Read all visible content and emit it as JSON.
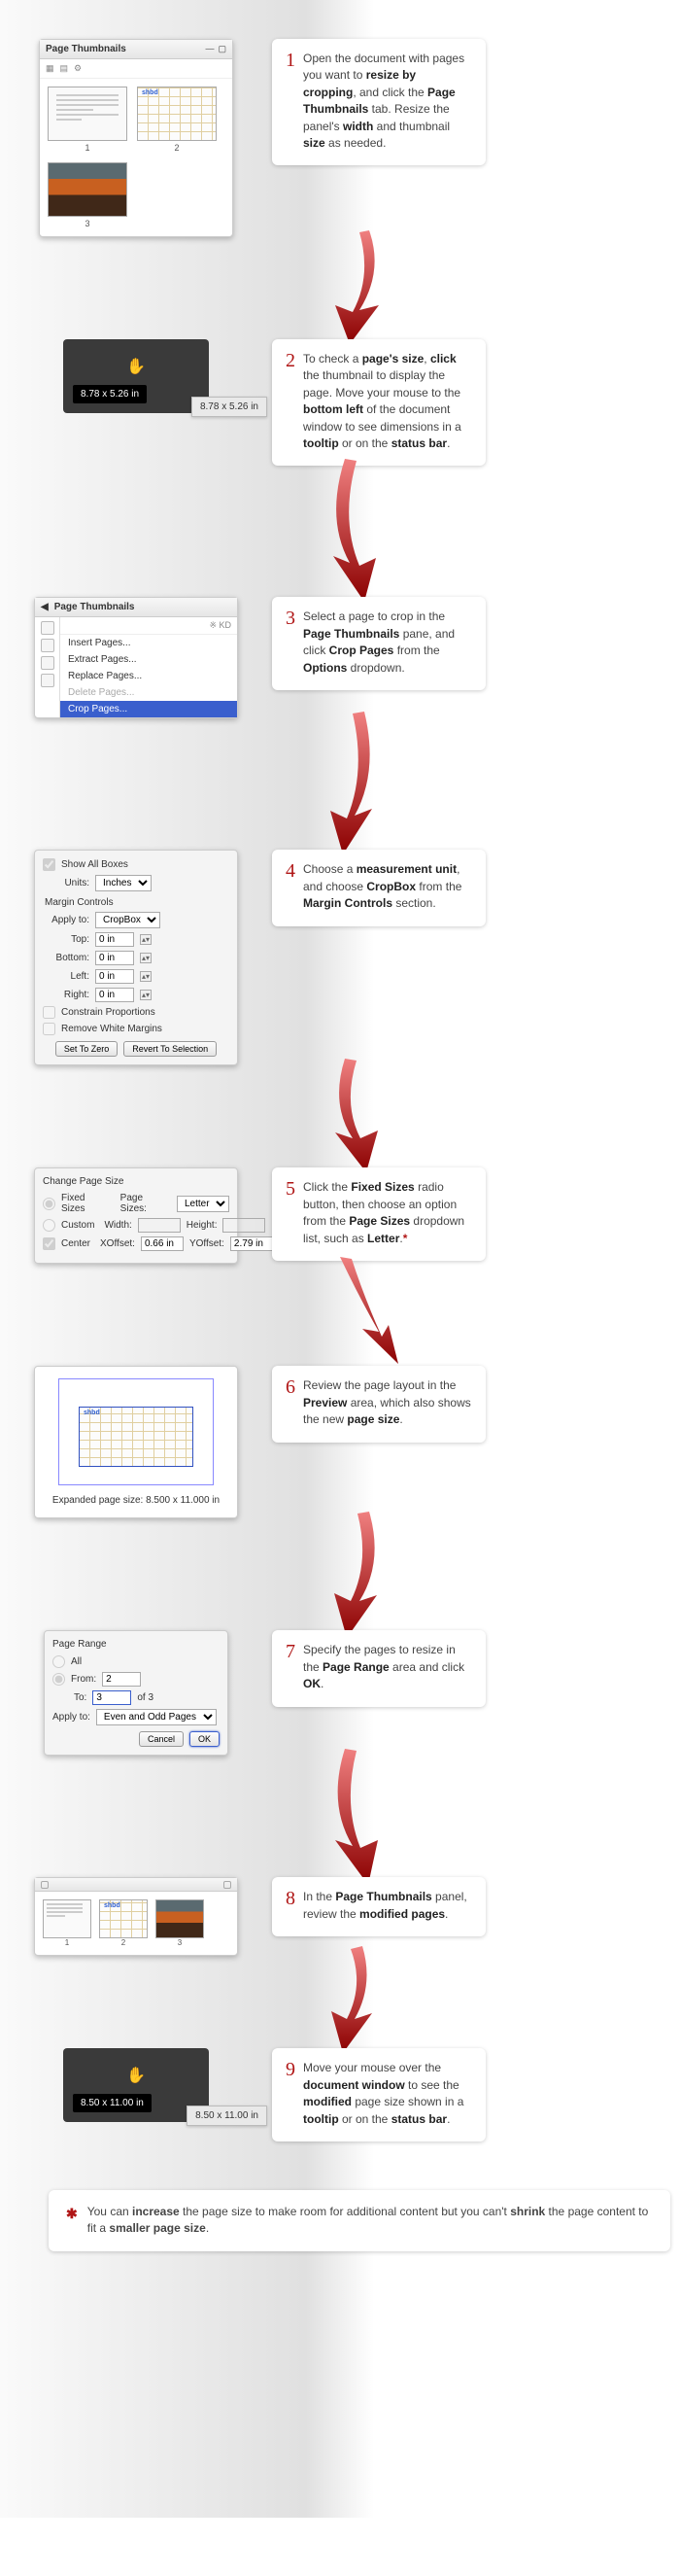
{
  "steps": {
    "1": {
      "part_a": "Open the document with pages you want to ",
      "b1": "resize by cropping",
      "mid1": ", and click the ",
      "b2": "Page Thumbnails",
      "mid2": " tab. Resize the panel's ",
      "b3": "width",
      "mid3": " and thumbnail ",
      "b4": "size",
      "end": " as needed."
    },
    "2": {
      "a": "To check a ",
      "b1": "page's size",
      "m1": ", ",
      "b2": "click",
      "m2": " the thumbnail to display the page. Move your mouse to the ",
      "b3": "bottom left",
      "m3": " of the document window to see dimensions in a ",
      "b4": "tooltip",
      "m4": " or on the ",
      "b5": "status bar",
      "end": "."
    },
    "3": {
      "a": "Select a page to crop in the ",
      "b1": "Page Thumbnails",
      "m1": " pane, and click ",
      "b2": "Crop Pages",
      "m2": " from the ",
      "b3": "Options",
      "end": " dropdown."
    },
    "4": {
      "a": "Choose a ",
      "b1": "measurement unit",
      "m1": ", and choose ",
      "b2": "CropBox",
      "m2": " from the ",
      "b3": "Margin Controls",
      "end": " section."
    },
    "5": {
      "a": "Click the ",
      "b1": "Fixed Sizes",
      "m1": " radio button, then choose an option from the ",
      "b2": "Page Sizes",
      "m2": " dropdown list, such as ",
      "b3": "Letter",
      "end": "."
    },
    "6": {
      "a": " Review the page layout in the ",
      "b1": "Preview",
      "m1": " area, which also shows the new ",
      "b2": "page size",
      "end": "."
    },
    "7": {
      "a": "Specify the pages to resize in the ",
      "b1": "Page Range",
      "m1": " area and click ",
      "b2": "OK",
      "end": "."
    },
    "8": {
      "a": "In the ",
      "b1": "Page Thumbnails",
      "m1": " panel, review the ",
      "b2": "modified pages",
      "end": "."
    },
    "9": {
      "a": "Move your mouse over the ",
      "b1": "document window",
      "m1": " to see the ",
      "b2": "modified",
      "m2": " page size shown in a ",
      "b3": "tooltip",
      "m3": " or on the ",
      "b4": "status bar",
      "end": "."
    }
  },
  "panel1": {
    "title": "Page Thumbnails",
    "thumb_labels": [
      "1",
      "2",
      "3"
    ]
  },
  "panel2": {
    "tooltip": "8.78 x 5.26 in",
    "statusbar": "8.78 x 5.26 in"
  },
  "panel3": {
    "title": "Page Thumbnails",
    "toolbar_tag": "※ KD",
    "menu": {
      "insert": "Insert Pages...",
      "extract": "Extract Pages...",
      "replace": "Replace Pages...",
      "delete": "Delete Pages...",
      "crop": "Crop Pages..."
    }
  },
  "panel4": {
    "show_all": "Show All Boxes",
    "units_lbl": "Units:",
    "units_val": "Inches",
    "margin_heading": "Margin Controls",
    "apply_lbl": "Apply to:",
    "apply_val": "CropBox",
    "top_lbl": "Top:",
    "top_val": "0 in",
    "bottom_lbl": "Bottom:",
    "bottom_val": "0 in",
    "left_lbl": "Left:",
    "left_val": "0 in",
    "right_lbl": "Right:",
    "right_val": "0 in",
    "constrain": "Constrain Proportions",
    "remove_white": "Remove White Margins",
    "btn_zero": "Set To Zero",
    "btn_revert": "Revert To Selection"
  },
  "panel5": {
    "heading": "Change Page Size",
    "fixed": "Fixed Sizes",
    "pagesizes_lbl": "Page Sizes:",
    "pagesizes_val": "Letter",
    "custom": "Custom",
    "width_lbl": "Width:",
    "height_lbl": "Height:",
    "center": "Center",
    "xoff_lbl": "XOffset:",
    "xoff_val": "0.66 in",
    "yoff_lbl": "YOffset:",
    "yoff_val": "2.79 in"
  },
  "panel6": {
    "caption_prefix": "Expanded page size: ",
    "caption_val": "8.500 x 11.000 in"
  },
  "panel7": {
    "heading": "Page Range",
    "all": "All",
    "from_lbl": "From:",
    "from_val": "2",
    "to_lbl": "To:",
    "to_val": "3",
    "of_lbl": "of 3",
    "apply_lbl": "Apply to:",
    "apply_val": "Even and Odd Pages",
    "cancel": "Cancel",
    "ok": "OK"
  },
  "panel8": {
    "labels": [
      "1",
      "2",
      "3"
    ]
  },
  "panel9": {
    "tooltip": "8.50 x 11.00 in",
    "statusbar": "8.50 x 11.00 in"
  },
  "footnote": {
    "mark": "✱",
    "a": "You can ",
    "b1": "increase",
    "m1": " the page size to make room for additional content but you can't ",
    "b2": "shrink",
    "m2": " the page content to fit a ",
    "b3": "smaller page size",
    "end": "."
  }
}
